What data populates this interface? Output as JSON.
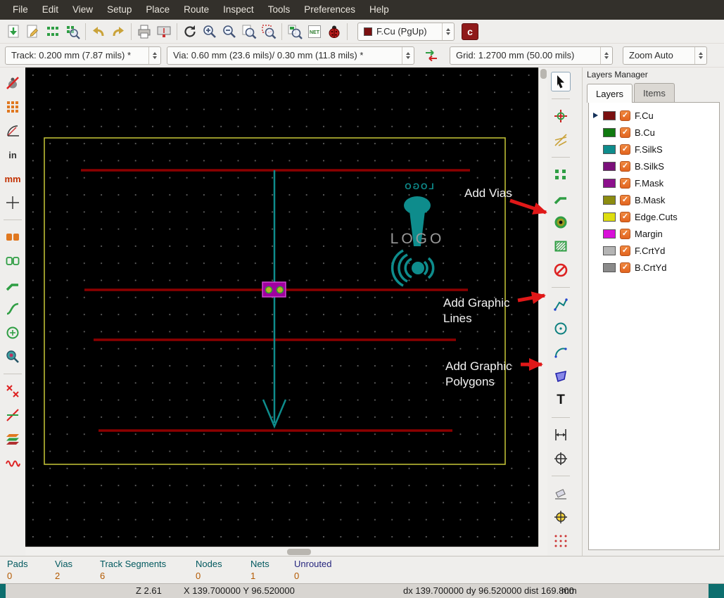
{
  "menu_bar": {
    "items": [
      "File",
      "Edit",
      "View",
      "Setup",
      "Place",
      "Route",
      "Inspect",
      "Tools",
      "Preferences",
      "Help"
    ]
  },
  "toolbar_main": {
    "layer_selector": {
      "value": "F.Cu (PgUp)",
      "swatch_color": "#7a1010"
    },
    "net_label": "NET",
    "plugin_label": "c"
  },
  "toolbar_settings": {
    "track": "Track: 0.200 mm (7.87 mils) *",
    "via": "Via: 0.60 mm (23.6 mils)/ 0.30 mm (11.8 mils) *",
    "grid": "Grid: 1.2700 mm (50.00 mils)",
    "zoom": "Zoom Auto"
  },
  "left_toolbar": {
    "inch_label": "in",
    "mm_label": "mm"
  },
  "right_toolbar": {
    "text_tool_label": "T"
  },
  "canvas": {
    "logo_text": "LOGO",
    "annotations": {
      "vias": "Add Vias",
      "lines_1": "Add Graphic",
      "lines_2": "Lines",
      "polygons_1": "Add Graphic",
      "polygons_2": "Polygons"
    },
    "colors": {
      "track": "#8c0000",
      "silkscreen": "#0e8c8c",
      "edge_cuts": "#c8c838",
      "pad": "#a000a0",
      "via": "#b8b820",
      "annotation_arrow": "#e01818",
      "annotation_text": "#f2f2f2"
    }
  },
  "layers_manager": {
    "title": "Layers Manager",
    "tabs": [
      {
        "label": "Layers",
        "active": true
      },
      {
        "label": "Items",
        "active": false
      }
    ],
    "layers": [
      {
        "name": "F.Cu",
        "color": "#7a1010",
        "checked": true,
        "active": true
      },
      {
        "name": "B.Cu",
        "color": "#107a10",
        "checked": true,
        "active": false
      },
      {
        "name": "F.SilkS",
        "color": "#0e8c8c",
        "checked": true,
        "active": false
      },
      {
        "name": "B.SilkS",
        "color": "#7a107a",
        "checked": true,
        "active": false
      },
      {
        "name": "F.Mask",
        "color": "#8c108c",
        "checked": true,
        "active": false
      },
      {
        "name": "B.Mask",
        "color": "#8c8c10",
        "checked": true,
        "active": false
      },
      {
        "name": "Edge.Cuts",
        "color": "#dede10",
        "checked": true,
        "active": false
      },
      {
        "name": "Margin",
        "color": "#d810d8",
        "checked": true,
        "active": false
      },
      {
        "name": "F.CrtYd",
        "color": "#b4b4b4",
        "checked": true,
        "active": false
      },
      {
        "name": "B.CrtYd",
        "color": "#8a8a8a",
        "checked": true,
        "active": false
      }
    ]
  },
  "status_bar": {
    "items": [
      {
        "label": "Pads",
        "value": "0"
      },
      {
        "label": "Vias",
        "value": "2"
      },
      {
        "label": "Track Segments",
        "value": "6"
      },
      {
        "label": "Nodes",
        "value": "0"
      },
      {
        "label": "Nets",
        "value": "1"
      },
      {
        "label": "Unrouted",
        "value": "0"
      }
    ]
  },
  "info_bar": {
    "zoom": "Z 2.61",
    "cursor": "X 139.700000 Y 96.520000",
    "relative": "dx 139.700000 dy 96.520000 dist 169.800",
    "units": "mm"
  }
}
